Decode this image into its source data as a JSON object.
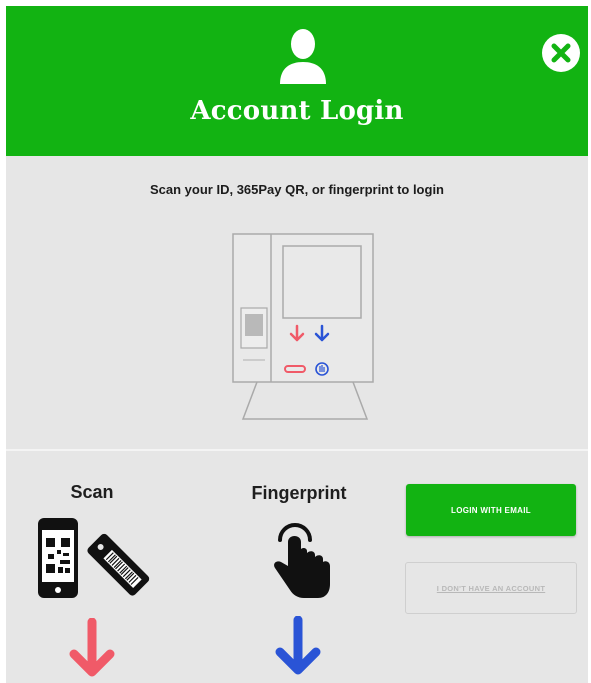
{
  "header": {
    "title": "Account Login",
    "user_icon": "user-silhouette-icon",
    "close_icon": "close-x-circle-icon"
  },
  "main": {
    "instruction": "Scan your ID, 365Pay QR, or fingerprint to login",
    "illustration": "kiosk-diagram"
  },
  "methods": {
    "scan_label": "Scan",
    "fingerprint_label": "Fingerprint"
  },
  "actions": {
    "login_email_label": "LOGIN WITH EMAIL",
    "no_account_label": "I DON'T HAVE AN ACCOUNT"
  },
  "colors": {
    "brand_green": "#12b312",
    "background": "#e6e6e6",
    "arrow_red": "#f05a68",
    "arrow_blue": "#2a54d6"
  }
}
